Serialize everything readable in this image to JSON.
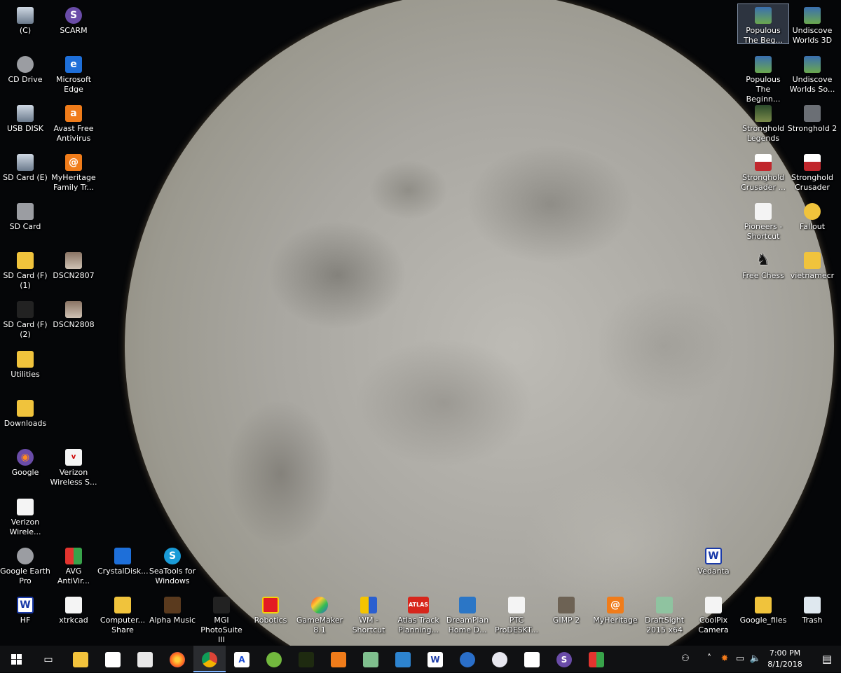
{
  "desktop": {
    "icons": {
      "c": {
        "label": "(C)",
        "icon": "drive-icon"
      },
      "scarm": {
        "label": "SCARM",
        "icon": "scarm-icon",
        "glyph": "S"
      },
      "cd_drive": {
        "label": "CD Drive",
        "icon": "cd-drive-icon"
      },
      "edge": {
        "label": "Microsoft Edge",
        "icon": "edge-icon",
        "glyph": "e"
      },
      "usb_disk": {
        "label": "USB DISK",
        "icon": "usb-icon"
      },
      "avast": {
        "label": "Avast Free Antivirus",
        "icon": "avast-icon",
        "glyph": "a"
      },
      "sd_card_e": {
        "label": "SD Card (E)",
        "icon": "sd-card-icon"
      },
      "myheritage_family": {
        "label": "MyHeritage Family Tr...",
        "icon": "myheritage-icon",
        "glyph": "@"
      },
      "sd_card": {
        "label": "SD Card",
        "icon": "sd-card-icon"
      },
      "sd_card_f1": {
        "label": "SD Card (F) (1)",
        "icon": "folder-icon"
      },
      "dscn2807": {
        "label": "DSCN2807",
        "icon": "photo-icon"
      },
      "sd_card_f2": {
        "label": "SD Card (F) (2)",
        "icon": "sd-card-icon"
      },
      "dscn2808": {
        "label": "DSCN2808",
        "icon": "photo-icon"
      },
      "utilities": {
        "label": "Utilities",
        "icon": "folder-icon"
      },
      "downloads": {
        "label": "Downloads",
        "icon": "downloads-icon"
      },
      "google": {
        "label": "Google",
        "icon": "firefox-icon",
        "glyph": "◉"
      },
      "verizon_s": {
        "label": "Verizon Wireless S...",
        "icon": "verizon-icon",
        "glyph": "v"
      },
      "verizon_wire": {
        "label": "Verizon Wirele...",
        "icon": "document-icon"
      },
      "google_earth": {
        "label": "Google Earth Pro",
        "icon": "google-earth-icon"
      },
      "avg": {
        "label": "AVG AntiVir...",
        "icon": "avg-icon"
      },
      "crystaldisk": {
        "label": "CrystalDisk...",
        "icon": "crystaldisk-icon"
      },
      "seatools": {
        "label": "SeaTools for Windows",
        "icon": "seatools-icon",
        "glyph": "S"
      },
      "hf": {
        "label": "HF",
        "icon": "word-icon",
        "glyph": "W"
      },
      "xtrkcad": {
        "label": "xtrkcad",
        "icon": "xtrkcad-icon"
      },
      "computer_share": {
        "label": "Computer... Share",
        "icon": "folder-icon"
      },
      "alpha_music": {
        "label": "Alpha Music",
        "icon": "music-icon"
      },
      "mgi": {
        "label": "MGI PhotoSuite III",
        "icon": "mgi-icon"
      },
      "robotics": {
        "label": "Robotics",
        "icon": "robotics-icon"
      },
      "gamemaker": {
        "label": "GameMaker 8.1",
        "icon": "gamemaker-icon"
      },
      "wm_shortcut": {
        "label": "WM - Shortcut",
        "icon": "wm-icon"
      },
      "atlas": {
        "label": "Atlas Track Planning...",
        "icon": "atlas-icon",
        "glyph": "ATLAS"
      },
      "dreamplan": {
        "label": "DreamPlan Home D...",
        "icon": "dreamplan-icon"
      },
      "ptc": {
        "label": "PTC ProDESKT...",
        "icon": "ptc-icon"
      },
      "gimp": {
        "label": "GIMP 2",
        "icon": "gimp-icon"
      },
      "myheritage": {
        "label": "MyHeritage",
        "icon": "myheritage-icon",
        "glyph": "@"
      },
      "draftsight": {
        "label": "DraftSight 2015 x64",
        "icon": "draftsight-icon"
      },
      "coolpix": {
        "label": "CoolPix Camera",
        "icon": "document-icon"
      },
      "google_files": {
        "label": "Google_files",
        "icon": "folder-icon"
      },
      "trash": {
        "label": "Trash",
        "icon": "recycle-bin-icon"
      },
      "vedanta": {
        "label": "Vedanta",
        "icon": "word-icon",
        "glyph": "W"
      },
      "populous_beg": {
        "label": "Populous The Beg...",
        "icon": "game-shortcut-icon"
      },
      "undiscovered_3d": {
        "label": "Undiscove Worlds 3D",
        "icon": "game-shortcut-icon"
      },
      "populous_beginn": {
        "label": "Populous The Beginn...",
        "icon": "game-shortcut-icon"
      },
      "undiscovered_so": {
        "label": "Undiscove Worlds So...",
        "icon": "game-shortcut-icon"
      },
      "stronghold_legends": {
        "label": "Stronghold Legends",
        "icon": "stronghold-legends-icon"
      },
      "stronghold2": {
        "label": "Stronghold 2",
        "icon": "stronghold-icon"
      },
      "stronghold_crusader_e": {
        "label": "Stronghold Crusader ...",
        "icon": "crusader-icon"
      },
      "stronghold_crusader": {
        "label": "Stronghold Crusader",
        "icon": "crusader-icon"
      },
      "pioneers": {
        "label": "Pioneers - Shortcut",
        "icon": "document-icon"
      },
      "fallout": {
        "label": "Fallout",
        "icon": "fallout-icon"
      },
      "free_chess": {
        "label": "Free Chess",
        "icon": "chess-knight-icon",
        "glyph": "♞"
      },
      "vietnamecr": {
        "label": "vietnamecr",
        "icon": "folder-icon"
      }
    }
  },
  "taskbar": {
    "clock_time": "7:00 PM",
    "clock_date": "8/1/2018",
    "pinned": [
      "start-icon",
      "task-view-icon",
      "file-explorer-icon",
      "store-icon",
      "calculator-icon",
      "firefox-icon",
      "chrome-icon",
      "autocad-icon",
      "greenapp-icon",
      "xtrkcad-icon",
      "myheritage-icon",
      "draftsight-icon",
      "photo-app-icon",
      "word-icon",
      "box-icon",
      "paint-icon",
      "xtrkcad-icon",
      "scarm-icon",
      "avg-icon"
    ]
  }
}
